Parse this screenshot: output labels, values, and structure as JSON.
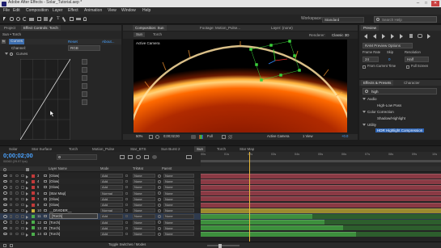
{
  "window": {
    "title": "Adobe After Effects - Solar_Tutorial.aep *"
  },
  "menu": [
    "File",
    "Edit",
    "Composition",
    "Layer",
    "Effect",
    "Animation",
    "View",
    "Window",
    "Help"
  ],
  "toolbar": {
    "workspace_label": "Workspace:",
    "workspace_value": "Standard",
    "search_placeholder": "Search Help"
  },
  "left_panel": {
    "comp_breadcrumb": "Sun • Torch",
    "tab_project": "Project",
    "tab_effect_controls": "Effect Controls: Torch",
    "effect_name": "Curves",
    "reset_label": "Reset",
    "about_label": "About...",
    "channel_label": "Channel:",
    "channel_value": "RGB",
    "curves_label": "Curves"
  },
  "viewer": {
    "tab_composition": "Composition: Sun",
    "tab_footage": "Footage: Motion_Pulse...",
    "tab_layer": "Layer: (none)",
    "breadcrumb_1": "Sun",
    "breadcrumb_2": "Torch",
    "active_camera": "Active Camera",
    "renderer_label": "Renderer:",
    "renderer_value": "Classic 3D",
    "zoom": "50%",
    "timecode": "0;00;02;00",
    "resolution": "Full",
    "camera_view": "Active Camera",
    "views": "1 View",
    "exposure": "+0.0"
  },
  "preview": {
    "tab": "Preview",
    "options_label": "RAM Preview Options",
    "frame_rate_label": "Frame Rate",
    "skip_label": "Skip",
    "resolution_label": "Resolution",
    "frame_rate_value": "24",
    "skip_value": "0",
    "resolution_value": "Half",
    "from_current_label": "From Current Time",
    "full_screen_label": "Full Screen"
  },
  "effects": {
    "tab": "Effects & Presets",
    "tab2": "Character",
    "search_value": "high",
    "categories": [
      {
        "name": "Audio",
        "items": [
          "High-Low Pass"
        ]
      },
      {
        "name": "Color Correction",
        "items": [
          "Shadow/Highlight"
        ]
      },
      {
        "name": "Utility",
        "items": [
          "HDR Highlight Compression"
        ]
      }
    ]
  },
  "comp_tabs": [
    "Solar",
    "Star Surface",
    "Torch",
    "Motion_Pulse",
    "Star_BTS",
    "Sun Burst 2",
    "Sun",
    "Torch",
    "Star Map"
  ],
  "timeline": {
    "timecode": "0;00;02;00",
    "fps_info": "00060 (29.97 fps)",
    "search_placeholder": "",
    "col_layer_name": "Layer Name",
    "col_mode": "Mode",
    "col_trkmat": "TrkMat",
    "col_parent": "Parent",
    "toggle_label": "Toggle Switches / Modes",
    "ruler_ticks": [
      "00s",
      "01s",
      "02s",
      "03s",
      "04s",
      "05s",
      "06s",
      "07s",
      "08s",
      "09s",
      "10s"
    ],
    "layers": [
      {
        "num": "3",
        "name": "[Glow]",
        "mode": "Add",
        "trkmat": "None",
        "parent": "None",
        "color": "#c23a3a"
      },
      {
        "num": "4",
        "name": "[Glow]",
        "mode": "Add",
        "trkmat": "None",
        "parent": "None",
        "color": "#c23a3a"
      },
      {
        "num": "5",
        "name": "[Glow]",
        "mode": "Add",
        "trkmat": "None",
        "parent": "None",
        "color": "#c23a3a"
      },
      {
        "num": "6",
        "name": "[Star Map]",
        "mode": "Normal",
        "trkmat": "None",
        "parent": "None",
        "color": "#c23a3a"
      },
      {
        "num": "7",
        "name": "[Glow]",
        "mode": "Add",
        "trkmat": "None",
        "parent": "None",
        "color": "#c23a3a"
      },
      {
        "num": "8",
        "name": "[Glow]",
        "mode": "Add",
        "trkmat": "None",
        "parent": "None",
        "color": "#c23a3a"
      },
      {
        "num": "10",
        "name": "__DIVIDER__",
        "mode": "Normal",
        "trkmat": "None",
        "parent": "None",
        "color": "#c9b23c"
      },
      {
        "num": "11",
        "name": "[Torch]",
        "mode": "Add",
        "trkmat": "None",
        "parent": "None",
        "color": "#4cae4c"
      },
      {
        "num": "12",
        "name": "[Torch]",
        "mode": "Add",
        "trkmat": "None",
        "parent": "None",
        "color": "#4cae4c"
      },
      {
        "num": "13",
        "name": "[Torch]",
        "mode": "Add",
        "trkmat": "None",
        "parent": "None",
        "color": "#4cae4c"
      },
      {
        "num": "14",
        "name": "[Torch]",
        "mode": "Add",
        "trkmat": "None",
        "parent": "None",
        "color": "#4cae4c"
      }
    ]
  },
  "colors": {
    "accent_blue": "#2d8cf0",
    "layer_red": "#c23a3a",
    "layer_green": "#4cae4c",
    "divider_yellow": "#c9b23c",
    "playhead": "#e8b83a"
  }
}
